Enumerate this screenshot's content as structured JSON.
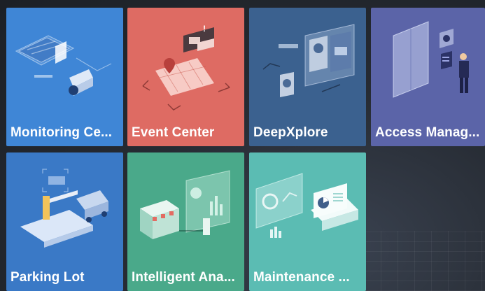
{
  "tiles": [
    {
      "label": "Monitoring Ce...",
      "icon": "monitoring-icon"
    },
    {
      "label": "Event Center",
      "icon": "event-icon"
    },
    {
      "label": "DeepXplore",
      "icon": "deepxplore-icon"
    },
    {
      "label": "Access Manag...",
      "icon": "access-icon"
    },
    {
      "label": "Parking Lot",
      "icon": "parking-icon"
    },
    {
      "label": "Intelligent Ana...",
      "icon": "analytics-icon"
    },
    {
      "label": "Maintenance ...",
      "icon": "maintenance-icon"
    }
  ],
  "colors": {
    "monitoring": "#3f86d6",
    "event": "#de6b63",
    "deepxplore": "#3b618f",
    "access": "#5b64a8",
    "parking": "#3a79c6",
    "analytics": "#4aa98a",
    "maintenance": "#5bbcb3",
    "background": "#262b33"
  }
}
